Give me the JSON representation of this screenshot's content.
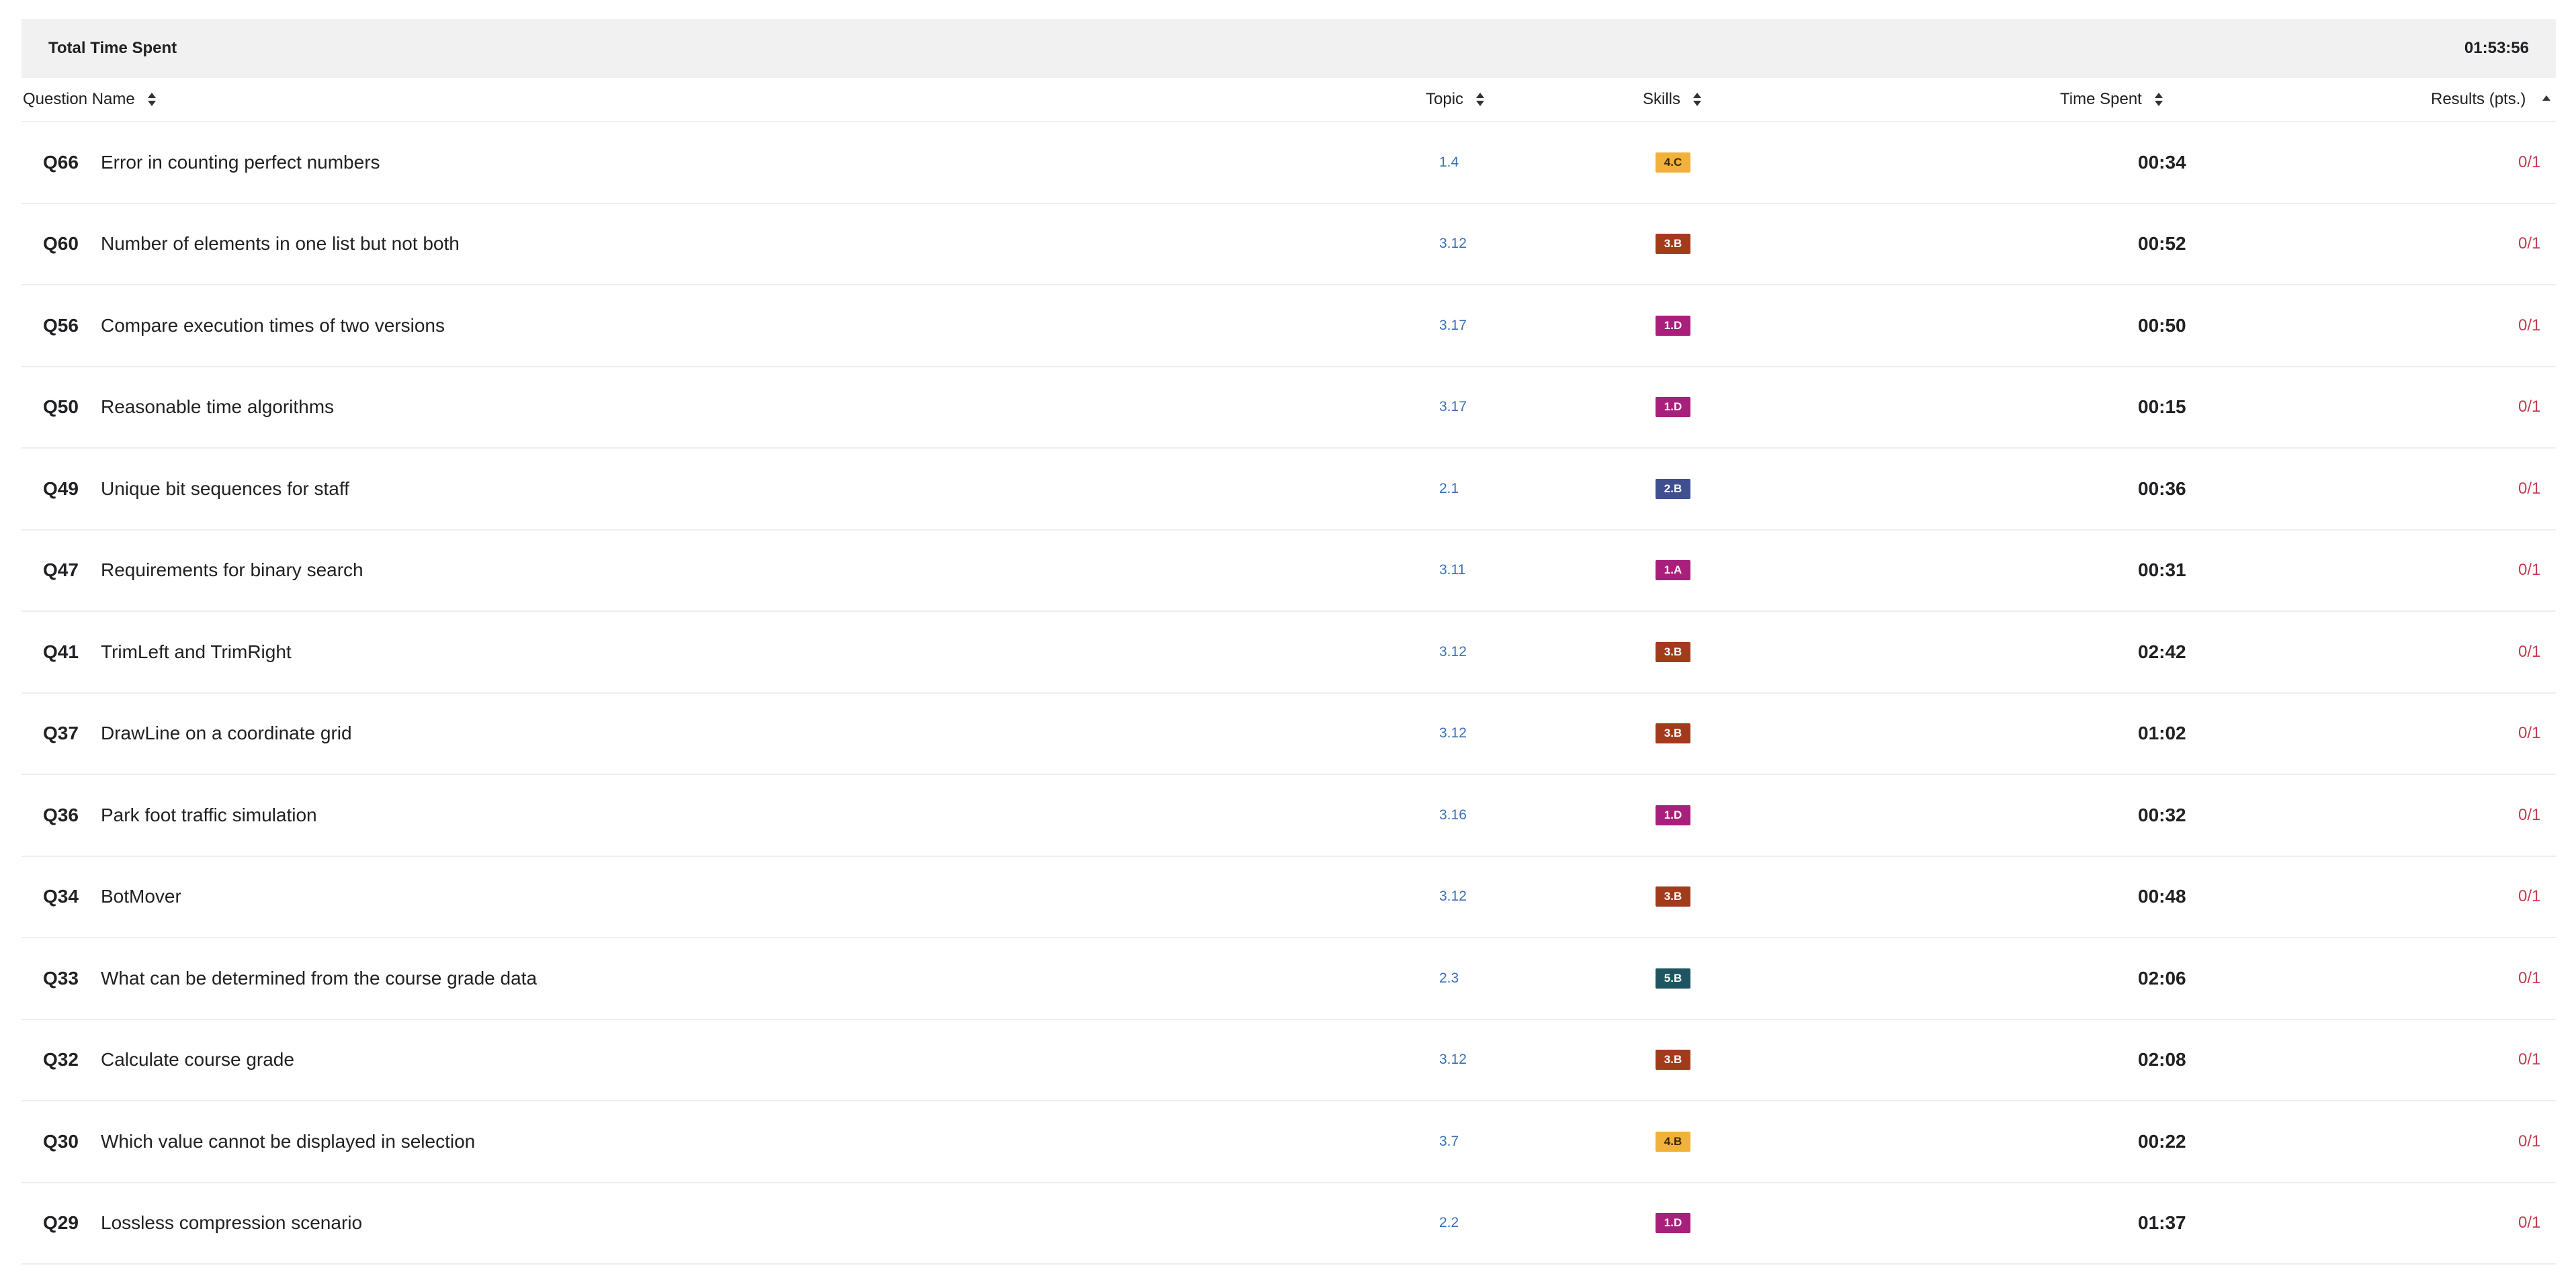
{
  "summary": {
    "label": "Total Time Spent",
    "value": "01:53:56"
  },
  "columns": {
    "question_name": "Question Name",
    "topic": "Topic",
    "skills": "Skills",
    "time_spent": "Time Spent",
    "results": "Results (pts.)"
  },
  "skill_colors": {
    "4.C": "#f0b23a",
    "4.B": "#f0b23a",
    "3.B": "#a23a1c",
    "1.D": "#a8207b",
    "1.A": "#a8207b",
    "2.B": "#3f4f8f",
    "5.B": "#1f5560"
  },
  "rows": [
    {
      "id": "Q66",
      "name": "Error in counting perfect numbers",
      "topic": "1.4",
      "skill": "4.C",
      "time": "00:34",
      "result": "0/1"
    },
    {
      "id": "Q60",
      "name": "Number of elements in one list but not both",
      "topic": "3.12",
      "skill": "3.B",
      "time": "00:52",
      "result": "0/1"
    },
    {
      "id": "Q56",
      "name": "Compare execution times of two versions",
      "topic": "3.17",
      "skill": "1.D",
      "time": "00:50",
      "result": "0/1"
    },
    {
      "id": "Q50",
      "name": "Reasonable time algorithms",
      "topic": "3.17",
      "skill": "1.D",
      "time": "00:15",
      "result": "0/1"
    },
    {
      "id": "Q49",
      "name": "Unique bit sequences for staff",
      "topic": "2.1",
      "skill": "2.B",
      "time": "00:36",
      "result": "0/1"
    },
    {
      "id": "Q47",
      "name": "Requirements for binary search",
      "topic": "3.11",
      "skill": "1.A",
      "time": "00:31",
      "result": "0/1"
    },
    {
      "id": "Q41",
      "name": "TrimLeft and TrimRight",
      "topic": "3.12",
      "skill": "3.B",
      "time": "02:42",
      "result": "0/1"
    },
    {
      "id": "Q37",
      "name": "DrawLine on a coordinate grid",
      "topic": "3.12",
      "skill": "3.B",
      "time": "01:02",
      "result": "0/1"
    },
    {
      "id": "Q36",
      "name": "Park foot traffic simulation",
      "topic": "3.16",
      "skill": "1.D",
      "time": "00:32",
      "result": "0/1"
    },
    {
      "id": "Q34",
      "name": "BotMover",
      "topic": "3.12",
      "skill": "3.B",
      "time": "00:48",
      "result": "0/1"
    },
    {
      "id": "Q33",
      "name": "What can be determined from the course grade data",
      "topic": "2.3",
      "skill": "5.B",
      "time": "02:06",
      "result": "0/1"
    },
    {
      "id": "Q32",
      "name": "Calculate course grade",
      "topic": "3.12",
      "skill": "3.B",
      "time": "02:08",
      "result": "0/1"
    },
    {
      "id": "Q30",
      "name": "Which value cannot be displayed in selection",
      "topic": "3.7",
      "skill": "4.B",
      "time": "00:22",
      "result": "0/1"
    },
    {
      "id": "Q29",
      "name": "Lossless compression scenario",
      "topic": "2.2",
      "skill": "1.D",
      "time": "01:37",
      "result": "0/1"
    }
  ]
}
